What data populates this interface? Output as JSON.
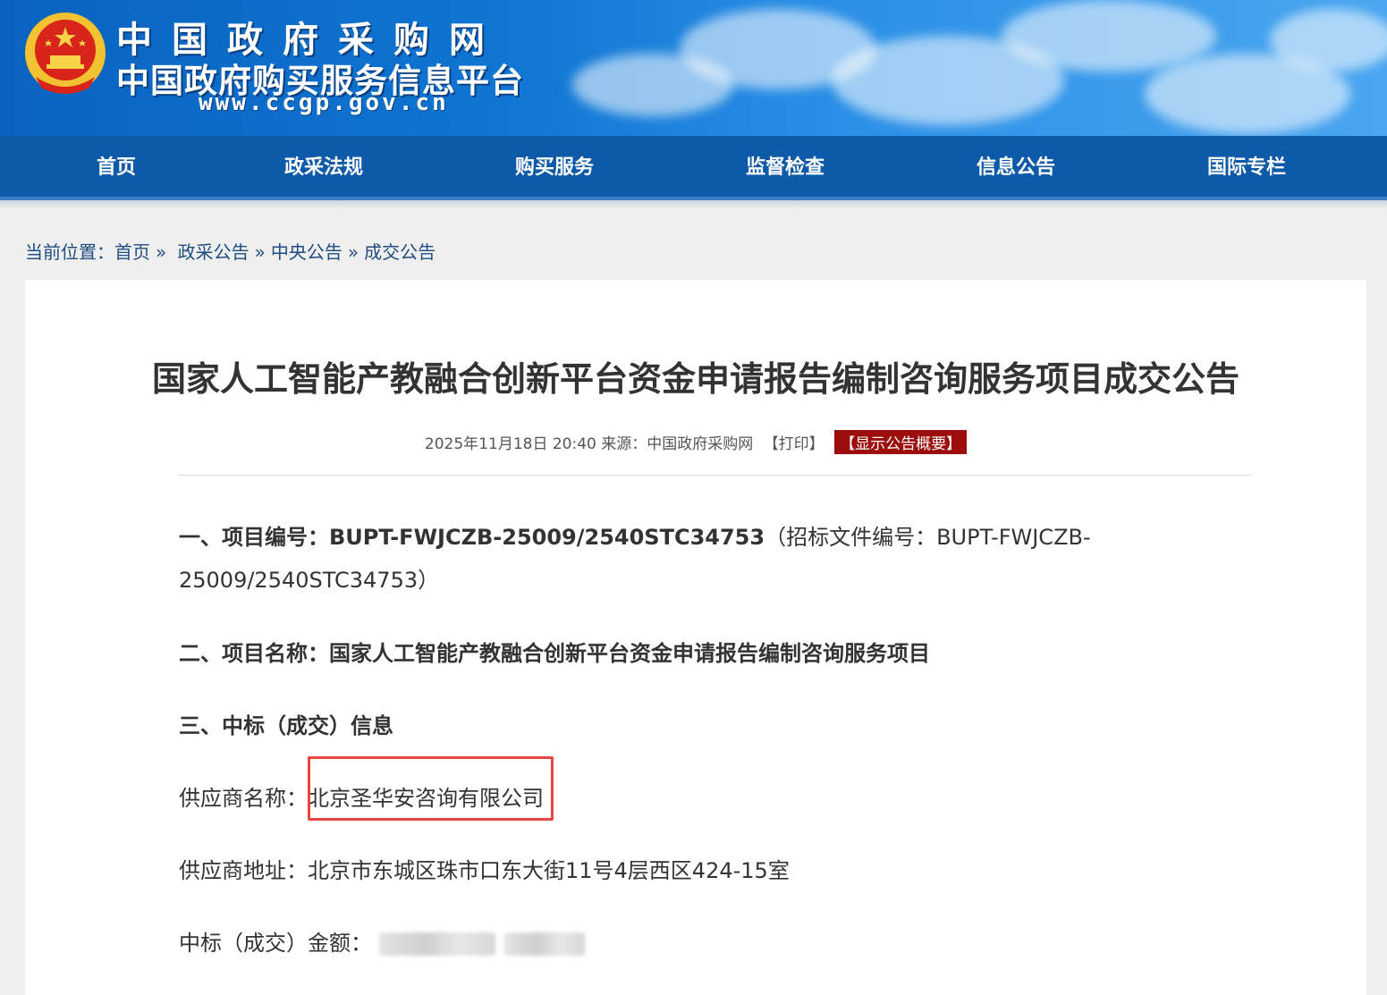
{
  "site": {
    "name_line1": "中国政府采购网",
    "name_line2": "中国政府购买服务信息平台",
    "url": "www.ccgp.gov.cn"
  },
  "nav": {
    "items": [
      {
        "label": "首页"
      },
      {
        "label": "政采法规"
      },
      {
        "label": "购买服务"
      },
      {
        "label": "监督检查"
      },
      {
        "label": "信息公告"
      },
      {
        "label": "国际专栏"
      }
    ]
  },
  "breadcrumb": {
    "prefix": "当前位置：",
    "items": [
      "首页",
      "政采公告",
      "中央公告",
      "成交公告"
    ],
    "separator": "»"
  },
  "article": {
    "title": "国家人工智能产教融合创新平台资金申请报告编制咨询服务项目成交公告",
    "meta_date": "2025年11月18日 20:40",
    "meta_source": "来源：中国政府采购网",
    "print_label": "【打印】",
    "summary_label": "【显示公告概要】",
    "sec1_label": "一、项目编号：",
    "sec1_value": "BUPT-FWJCZB-25009/2540STC34753",
    "sec1_note_a": "（招标文件编号：BUPT-FWJCZB-",
    "sec1_note_b": "25009/2540STC34753）",
    "sec2_label": "二、项目名称：",
    "sec2_value": "国家人工智能产教融合创新平台资金申请报告编制咨询服务项目",
    "sec3_label": "三、中标（成交）信息",
    "supplier_name_label": "供应商名称：",
    "supplier_name": "北京圣华安咨询有限公司",
    "supplier_addr_label": "供应商地址：",
    "supplier_addr": "北京市东城区珠市口东大街11号4层西区424-15室",
    "amount_label": "中标（成交）金额："
  },
  "colors": {
    "nav_bg": "#0c5aa8",
    "summary_bg": "#9c0d0d",
    "highlight_border": "#e8473f"
  }
}
